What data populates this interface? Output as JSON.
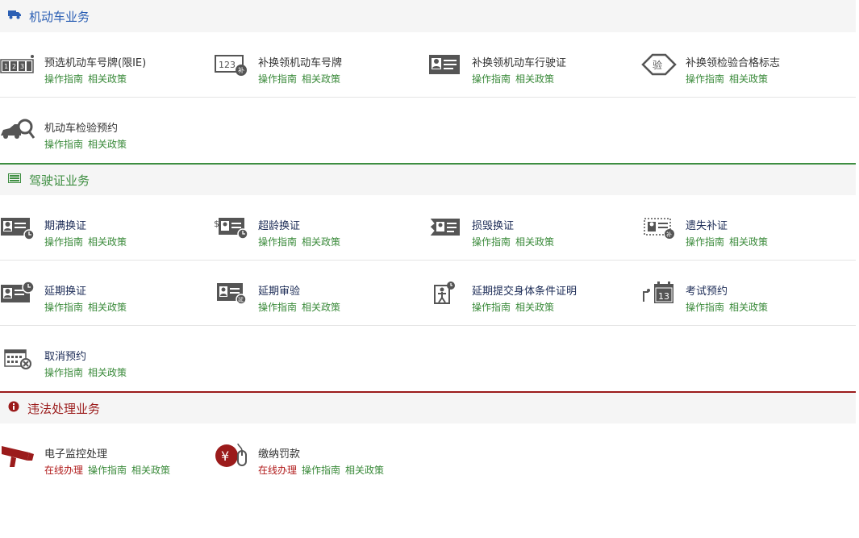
{
  "sections": [
    {
      "title": "机动车业务",
      "icon": "truck-icon",
      "color": "#2b5fb4",
      "rows": [
        [
          {
            "name": "预选机动车号牌(限IE)",
            "icon": "license-plate-icon",
            "links": [
              "操作指南",
              "相关政策"
            ]
          },
          {
            "name": "补换领机动车号牌",
            "icon": "plate-replace-icon",
            "links": [
              "操作指南",
              "相关政策"
            ]
          },
          {
            "name": "补换领机动车行驶证",
            "icon": "vehicle-license-icon",
            "links": [
              "操作指南",
              "相关政策"
            ]
          },
          {
            "name": "补换领检验合格标志",
            "icon": "inspection-mark-icon",
            "links": [
              "操作指南",
              "相关政策"
            ]
          }
        ],
        [
          {
            "name": "机动车检验预约",
            "icon": "vehicle-inspection-icon",
            "links": [
              "操作指南",
              "相关政策"
            ]
          }
        ]
      ]
    },
    {
      "title": "驾驶证业务",
      "icon": "id-card-icon",
      "color": "#3e8e41",
      "rows": [
        [
          {
            "name": "期满换证",
            "icon": "expired-license-icon",
            "links": [
              "操作指南",
              "相关政策"
            ]
          },
          {
            "name": "超龄换证",
            "icon": "overage-license-icon",
            "links": [
              "操作指南",
              "相关政策"
            ]
          },
          {
            "name": "损毁换证",
            "icon": "damaged-license-icon",
            "links": [
              "操作指南",
              "相关政策"
            ]
          },
          {
            "name": "遗失补证",
            "icon": "lost-license-icon",
            "links": [
              "操作指南",
              "相关政策"
            ]
          }
        ],
        [
          {
            "name": "延期换证",
            "icon": "delay-renewal-icon",
            "links": [
              "操作指南",
              "相关政策"
            ]
          },
          {
            "name": "延期审验",
            "icon": "delay-review-icon",
            "links": [
              "操作指南",
              "相关政策"
            ]
          },
          {
            "name": "延期提交身体条件证明",
            "icon": "health-proof-icon",
            "links": [
              "操作指南",
              "相关政策"
            ]
          },
          {
            "name": "考试预约",
            "icon": "exam-calendar-icon",
            "links": [
              "操作指南",
              "相关政策"
            ]
          }
        ],
        [
          {
            "name": "取消预约",
            "icon": "cancel-booking-icon",
            "links": [
              "操作指南",
              "相关政策"
            ]
          }
        ]
      ]
    },
    {
      "title": "违法处理业务",
      "icon": "info-icon",
      "color": "#9b1b1b",
      "rows": [
        [
          {
            "name": "电子监控处理",
            "icon": "camera-icon",
            "online": "在线办理",
            "links": [
              "操作指南",
              "相关政策"
            ]
          },
          {
            "name": "缴纳罚款",
            "icon": "pay-fine-icon",
            "online": "在线办理",
            "links": [
              "操作指南",
              "相关政策"
            ]
          }
        ]
      ]
    }
  ]
}
